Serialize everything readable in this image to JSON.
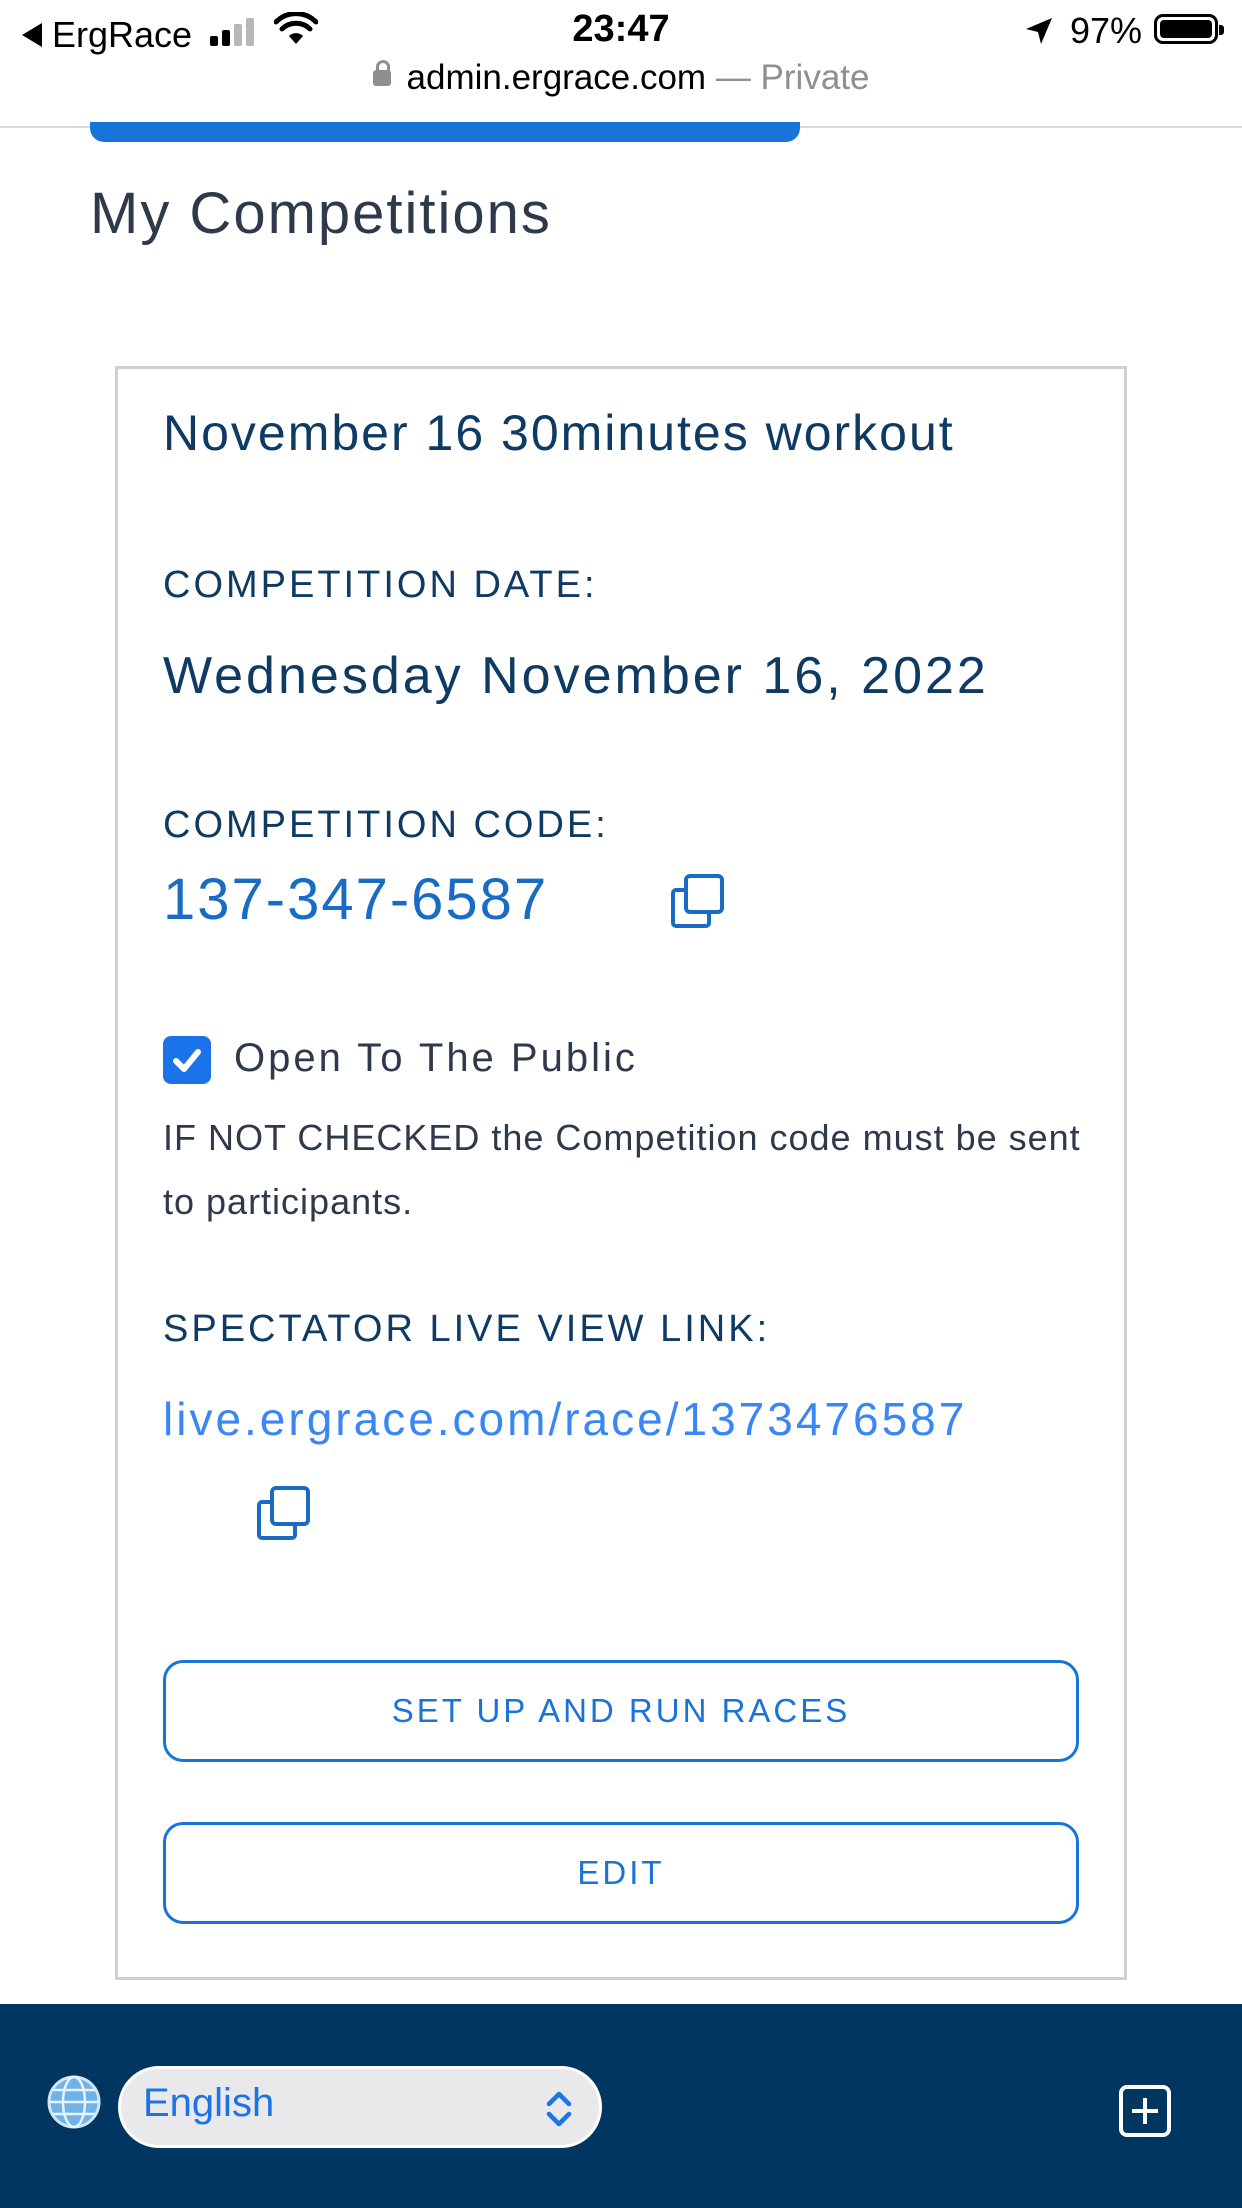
{
  "status_bar": {
    "back_app": "ErgRace",
    "time": "23:47",
    "battery_percent": "97%",
    "signal_bars_filled": 2,
    "signal_bars_total": 4
  },
  "browser": {
    "url": "admin.ergrace.com",
    "privacy_label": "— Private"
  },
  "page": {
    "title": "My Competitions"
  },
  "competition": {
    "name": "November 16 30minutes workout",
    "date_label": "COMPETITION DATE:",
    "date_value": "Wednesday November 16, 2022",
    "code_label": "COMPETITION CODE:",
    "code_value": "137-347-6587",
    "public_checkbox_label": "Open To The Public",
    "public_checked": true,
    "public_note": "IF NOT CHECKED the Competition code must be sent to participants.",
    "live_link_label": "SPECTATOR LIVE VIEW LINK:",
    "live_link": "live.ergrace.com/race/1373476587",
    "setup_button": "SET UP AND RUN RACES",
    "edit_button": "EDIT"
  },
  "footer": {
    "language_selected": "English"
  },
  "colors": {
    "accent_blue": "#1a73d9",
    "navy": "#0e3a64",
    "footer_bg": "#00365f",
    "link_blue": "#3a86f5"
  },
  "icons": [
    "location-arrow-icon",
    "lock-icon",
    "copy-icon",
    "check-icon",
    "globe-icon",
    "updown-chevron-icon",
    "new-tab-icon"
  ]
}
